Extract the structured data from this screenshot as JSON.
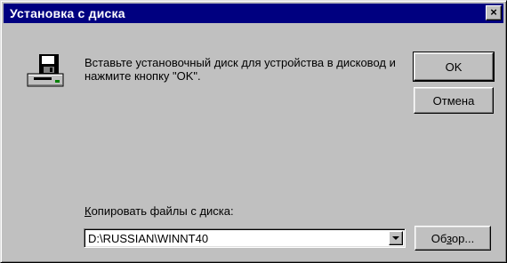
{
  "window": {
    "title": "Установка с диска",
    "close_glyph": "×"
  },
  "message": {
    "text": "Вставьте установочный диск для устройства в дисковод и нажмите кнопку \"OK\"."
  },
  "buttons": {
    "ok": "OK",
    "cancel": "Отмена",
    "browse_pre": "Об",
    "browse_mnemonic": "з",
    "browse_post": "ор..."
  },
  "copy_from": {
    "label_mnemonic": "К",
    "label_rest": "опировать файлы с диска:",
    "value": "D:\\RUSSIAN\\WINNT40"
  },
  "icons": {
    "disk": "floppy-drive-icon",
    "dropdown": "chevron-down-icon"
  },
  "colors": {
    "titlebar": "#000080",
    "face": "#c0c0c0"
  }
}
